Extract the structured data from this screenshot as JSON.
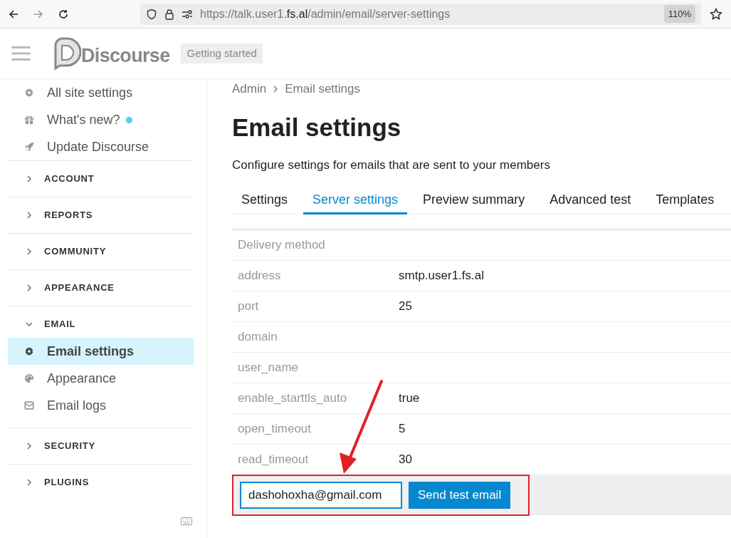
{
  "browser": {
    "url": {
      "before": "https://talk.user1.",
      "domain": "fs.al",
      "after": "/admin/email/server-settings"
    },
    "zoom": "110%"
  },
  "header": {
    "logo": "Discourse",
    "badge": "Getting started"
  },
  "sidebar": {
    "links": [
      {
        "label": "All site settings",
        "new_dot": false
      },
      {
        "label": "What's new?",
        "new_dot": true
      },
      {
        "label": "Update Discourse",
        "new_dot": false
      }
    ],
    "sections": [
      {
        "label": "ACCOUNT",
        "expanded": false
      },
      {
        "label": "REPORTS",
        "expanded": false
      },
      {
        "label": "COMMUNITY",
        "expanded": false
      },
      {
        "label": "APPEARANCE",
        "expanded": false
      },
      {
        "label": "EMAIL",
        "expanded": true,
        "items": [
          {
            "label": "Email settings",
            "selected": true
          },
          {
            "label": "Appearance",
            "selected": false
          },
          {
            "label": "Email logs",
            "selected": false
          }
        ]
      },
      {
        "label": "SECURITY",
        "expanded": false
      },
      {
        "label": "PLUGINS",
        "expanded": false
      }
    ]
  },
  "breadcrumb": [
    "Admin",
    "Email settings"
  ],
  "title": "Email settings",
  "description": "Configure settings for emails that are sent to your members",
  "tabs": [
    {
      "label": "Settings",
      "selected": false
    },
    {
      "label": "Server settings",
      "selected": true
    },
    {
      "label": "Preview summary",
      "selected": false
    },
    {
      "label": "Advanced test",
      "selected": false
    },
    {
      "label": "Templates",
      "selected": false
    }
  ],
  "settings": {
    "heading": "Delivery method",
    "rows": [
      {
        "name": "address",
        "value": "smtp.user1.fs.al"
      },
      {
        "name": "port",
        "value": "25"
      },
      {
        "name": "domain"
      },
      {
        "name": "user_name"
      },
      {
        "name": "enable_starttls_auto",
        "value": "true"
      },
      {
        "name": "open_timeout",
        "value": "5"
      },
      {
        "name": "read_timeout",
        "value": "30"
      }
    ]
  },
  "test_email": {
    "value": "dashohoxha@gmail.com",
    "button": "Send test email"
  }
}
